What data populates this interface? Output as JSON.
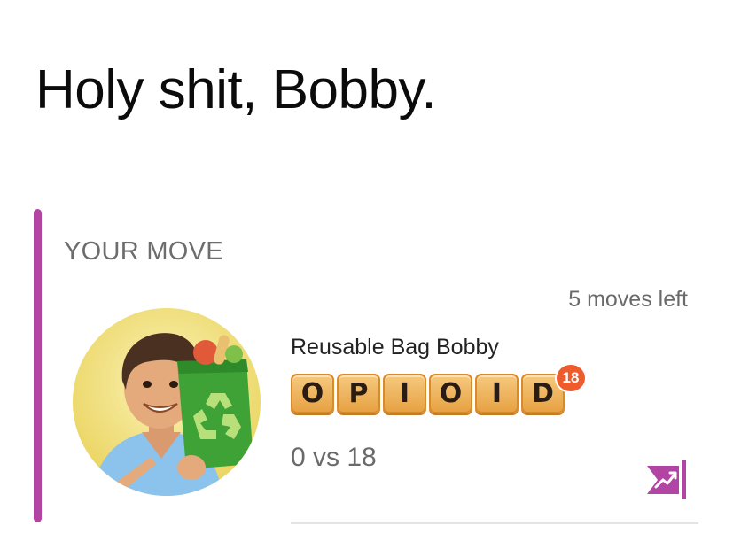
{
  "headline": "Holy shit, Bobby.",
  "section": {
    "label": "YOUR MOVE"
  },
  "game": {
    "moves_left": "5 moves left",
    "opponent_name": "Reusable Bag Bobby",
    "word_tiles": [
      "O",
      "P",
      "I",
      "O",
      "I",
      "D"
    ],
    "word_score": "18",
    "score": "0 vs 18",
    "avatar_icon": "avatar-man-with-recycling-bag",
    "action_icon": "trend-chart-icon"
  },
  "colors": {
    "accent": "#b244a4",
    "tile": "#f0b865",
    "badge": "#ee5b2d"
  }
}
